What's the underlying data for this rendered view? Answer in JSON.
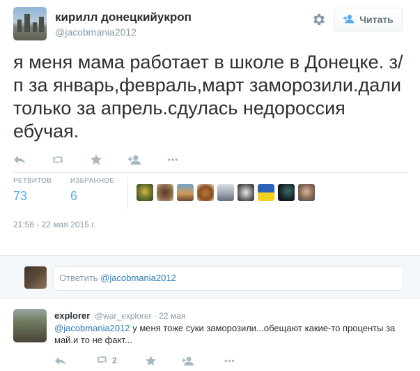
{
  "tweet": {
    "author_name": "кирилл донецкийукроп",
    "author_handle": "@jacobmania2012",
    "follow_label": "Читать",
    "text": "я меня мама работает в школе в Донецке. з/п за январь,февраль,март заморозили.дали только за апрель.сдулась недороссия ебучая.",
    "stats": {
      "retweets_label": "РЕТВИТОВ",
      "retweets_value": "73",
      "favorites_label": "ИЗБРАННОЕ",
      "favorites_value": "6"
    },
    "timestamp": "21:56 - 22 мая 2015 г.",
    "icons": [
      "reply-icon",
      "retweet-icon",
      "favorite-icon",
      "follow-icon",
      "more-icon"
    ]
  },
  "reply_box": {
    "prefix": "Ответить ",
    "mention": "@jacobmania2012"
  },
  "reply": {
    "author_name": "explorer",
    "author_handle": "@war_explorer · 22 мая",
    "mention": "@jacobmania2012",
    "text": " у меня тоже суки заморозили...обещают какие-то проценты за май.и то не факт...",
    "retweet_count": "2"
  },
  "colors": {
    "link": "#55acee",
    "mention": "#2b7bb9",
    "muted": "#8899a6",
    "text": "#292f33",
    "icon": "#aab8c2"
  }
}
